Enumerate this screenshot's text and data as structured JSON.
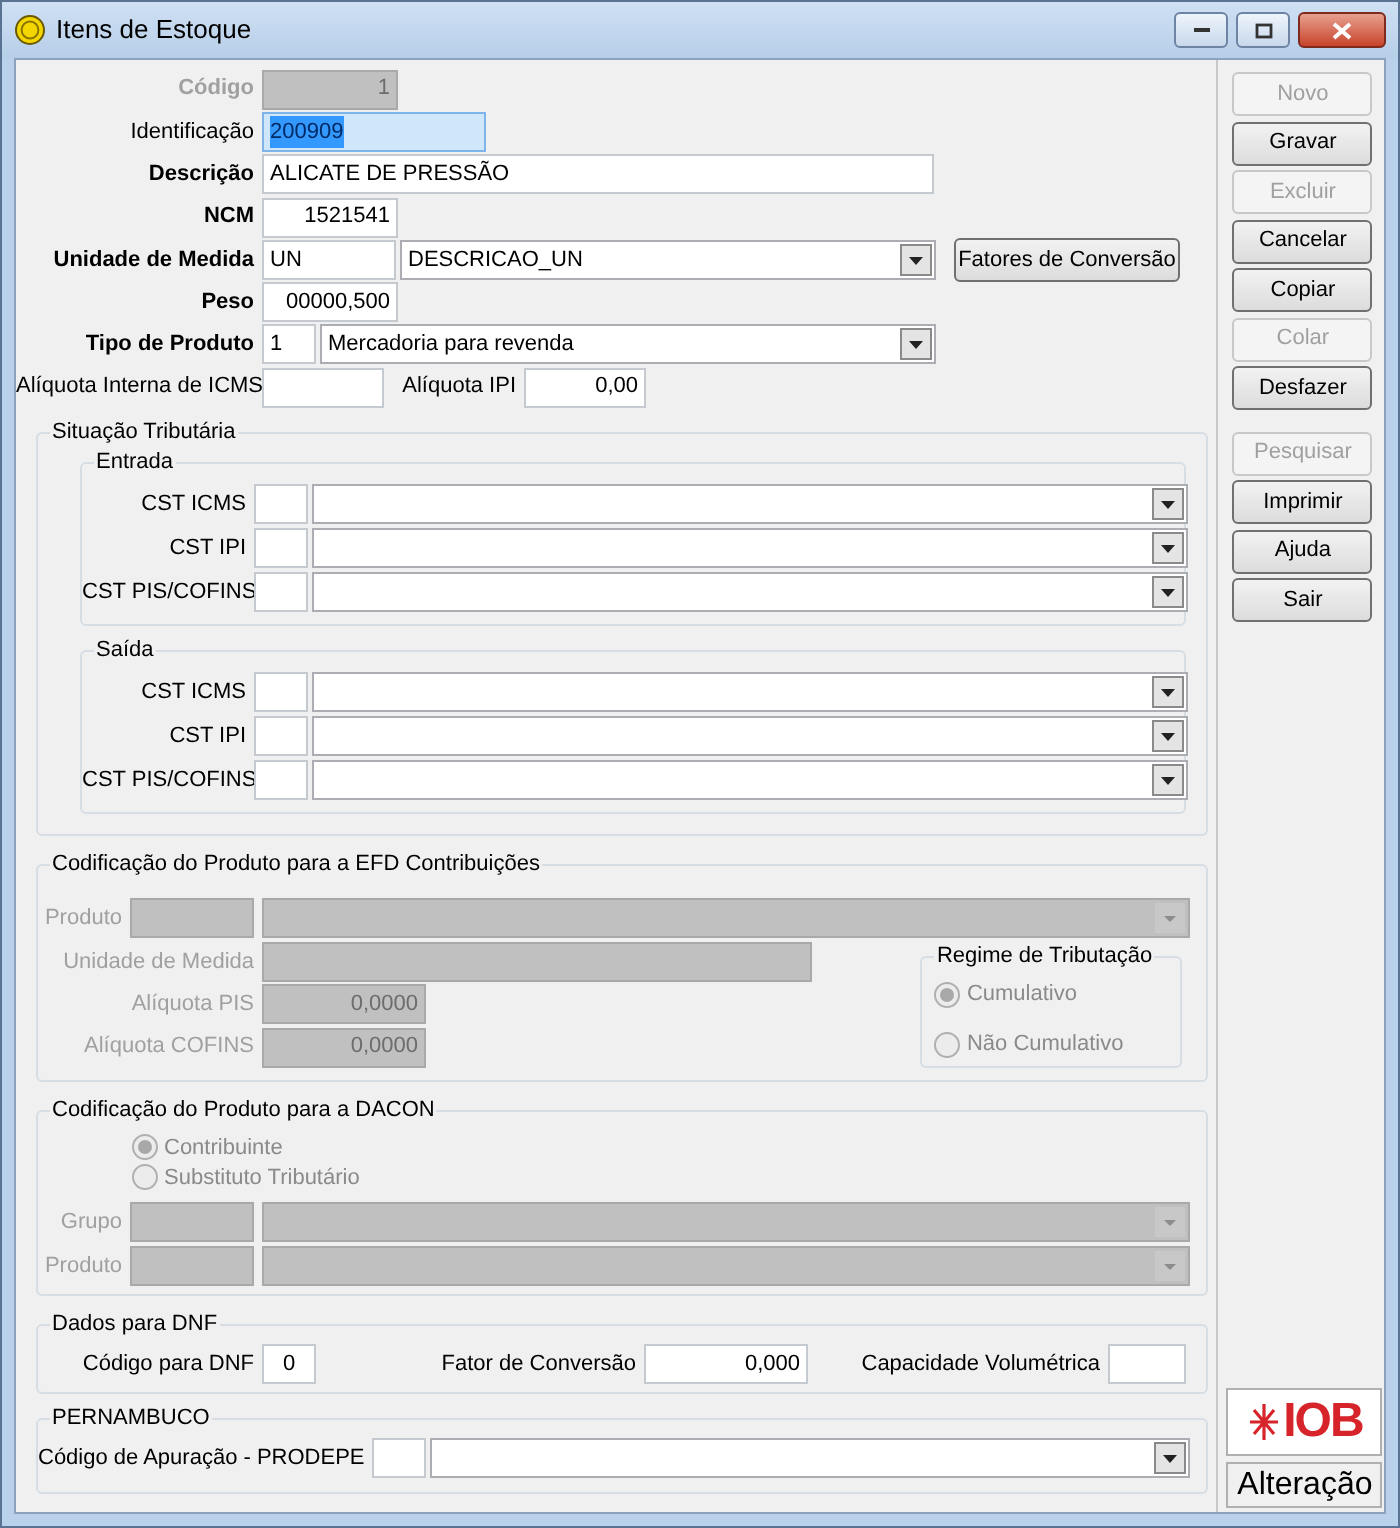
{
  "window": {
    "title": "Itens de Estoque"
  },
  "codigo": {
    "label": "Código",
    "bold": true,
    "disabled": true,
    "value": "1"
  },
  "identificacao": {
    "label": "Identificação",
    "bold": false,
    "highlighted": true,
    "value": "200909"
  },
  "descricao": {
    "label": "Descrição",
    "bold": true,
    "value": "ALICATE DE PRESSÃO"
  },
  "ncm": {
    "label": "NCM",
    "bold": true,
    "value": "1521541"
  },
  "unidade_medida": {
    "label": "Unidade de Medida",
    "bold": true,
    "code": "UN",
    "description": "DESCRICAO_UN",
    "button": "Fatores de Conversão"
  },
  "peso": {
    "label": "Peso",
    "bold": true,
    "value": "00000,500"
  },
  "tipo_produto": {
    "label": "Tipo de Produto",
    "bold": true,
    "code": "1",
    "description": "Mercadoria para revenda"
  },
  "aliquota_interna_icms": {
    "label": "Alíquota Interna de ICMS",
    "bold": false
  },
  "aliquota_ipi": {
    "label": "Alíquota IPI",
    "bold": false,
    "value": "0,00"
  },
  "situacao_tributaria": {
    "title": "Situação Tributária",
    "groups": [
      {
        "title": "Entrada",
        "rows": [
          {
            "label": "CST ICMS"
          },
          {
            "label": "CST IPI"
          },
          {
            "label": "CST PIS/COFINS"
          }
        ]
      },
      {
        "title": "Saída",
        "rows": [
          {
            "label": "CST ICMS"
          },
          {
            "label": "CST IPI"
          },
          {
            "label": "CST PIS/COFINS"
          }
        ]
      }
    ]
  },
  "efd": {
    "title": "Codificação do Produto para a EFD Contribuições",
    "disabled": true,
    "rows": [
      {
        "kind": "combo",
        "label": "Produto"
      },
      {
        "kind": "field",
        "label": "Unidade de Medida"
      },
      {
        "kind": "number",
        "label": "Alíquota PIS",
        "value": "0,0000"
      },
      {
        "kind": "number",
        "label": "Alíquota COFINS",
        "value": "0,0000"
      }
    ],
    "regime": {
      "title": "Regime de Tributação",
      "options": [
        {
          "label": "Cumulativo",
          "selected": true
        },
        {
          "label": "Não Cumulativo",
          "selected": false
        }
      ]
    }
  },
  "dacon": {
    "title": "Codificação do Produto para a DACON",
    "disabled": true,
    "options": [
      {
        "label": "Contribuinte",
        "selected": true
      },
      {
        "label": "Substituto Tributário",
        "selected": false
      }
    ],
    "rows": [
      {
        "label": "Grupo"
      },
      {
        "label": "Produto"
      }
    ]
  },
  "dnf": {
    "title": "Dados para DNF",
    "fields": [
      {
        "label": "Código para DNF",
        "value": "0"
      },
      {
        "label": "Fator de Conversão",
        "value": "0,000"
      },
      {
        "label": "Capacidade Volumétrica"
      }
    ]
  },
  "pernambuco": {
    "title": "PERNAMBUCO",
    "label": "Código de Apuração - PRODEPE"
  },
  "buttons": [
    {
      "label": "Novo",
      "disabled": true
    },
    {
      "label": "Gravar",
      "disabled": false
    },
    {
      "label": "Excluir",
      "disabled": true
    },
    {
      "label": "Cancelar",
      "disabled": false
    },
    {
      "label": "Copiar",
      "disabled": false
    },
    {
      "label": "Colar",
      "disabled": true
    },
    {
      "label": "Desfazer",
      "disabled": false
    },
    {
      "label": "Pesquisar",
      "disabled": true
    },
    {
      "label": "Imprimir",
      "disabled": false
    },
    {
      "label": "Ajuda",
      "disabled": false
    },
    {
      "label": "Sair",
      "disabled": false
    }
  ],
  "logo": {
    "text": "IOB"
  },
  "status": "Alteração"
}
